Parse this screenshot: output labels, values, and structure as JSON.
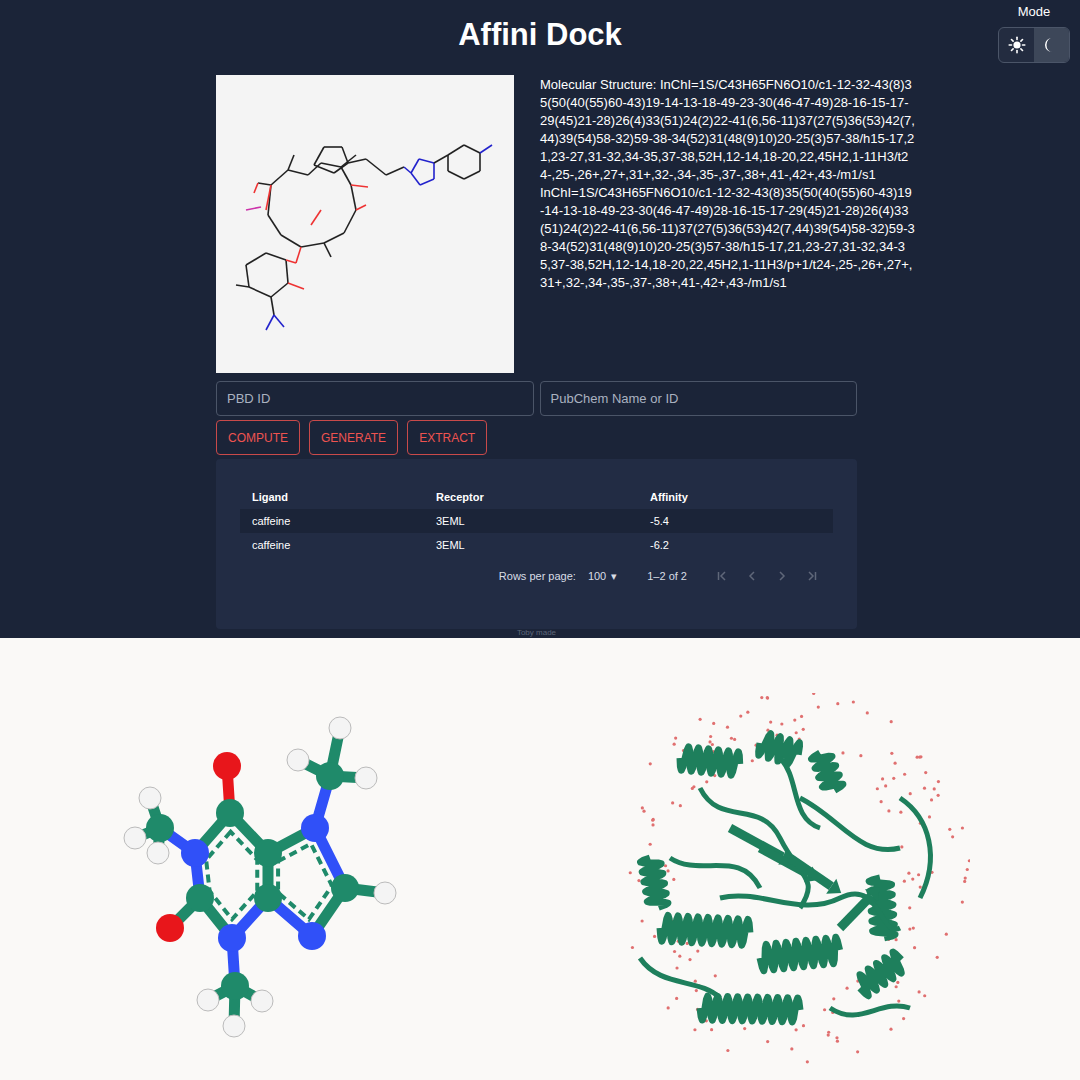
{
  "title": "Affini Dock",
  "mode": {
    "label": "Mode",
    "options": [
      {
        "kind": "light",
        "selected": false
      },
      {
        "kind": "dark",
        "selected": true
      }
    ]
  },
  "structure": {
    "label": "Molecular Structure:",
    "inchi": [
      "InChI=1S/C43H65FN6O10/c1-12-32-43(8)35(50(40(55)60-43)19-14-13-18-49-23-30(46-47-49)28-16-15-17-29(45)21-28)26(4)33(51)24(2)22-41(6,56-11)37(27(5)36(53)42(7,44)39(54)58-32)59-38-34(52)31(48(9)10)20-25(3)57-38/h15-17,21,23-27,31-32,34-35,37-38,52H,12-14,18-20,22,45H2,1-11H3/t24-,25-,26+,27+,31+,32-,34-,35-,37-,38+,41-,42+,43-/m1/s1",
      "InChI=1S/C43H65FN6O10/c1-12-32-43(8)35(50(40(55)60-43)19-14-13-18-49-23-30(46-47-49)28-16-15-17-29(45)21-28)26(4)33(51)24(2)22-41(6,56-11)37(27(5)36(53)42(7,44)39(54)58-32)59-38-34(52)31(48(9)10)20-25(3)57-38/h15-17,21,23-27,31-32,34-35,37-38,52H,12-14,18-20,22,45H2,1-11H3/p+1/t24-,25-,26+,27+,31+,32-,34-,35-,37-,38+,41-,42+,43-/m1/s1"
    ]
  },
  "inputs": [
    {
      "placeholder": "PBD ID"
    },
    {
      "placeholder": "PubChem Name or ID"
    }
  ],
  "buttons": [
    "COMPUTE",
    "GENERATE",
    "EXTRACT"
  ],
  "table": {
    "columns": [
      "Ligand",
      "Receptor",
      "Affinity"
    ],
    "rows": [
      {
        "cells": [
          "caffeine",
          "3EML",
          "-5.4"
        ],
        "selected": true
      },
      {
        "cells": [
          "caffeine",
          "3EML",
          "-6.2"
        ],
        "selected": false
      }
    ]
  },
  "pagination": {
    "label": "Rows per page:",
    "value": "100",
    "caret": "▾",
    "range": "1–2 of 2",
    "nav": [
      {
        "kind": "first",
        "disabled": true
      },
      {
        "kind": "prev",
        "disabled": true
      },
      {
        "kind": "next",
        "disabled": true
      },
      {
        "kind": "last",
        "disabled": true
      }
    ]
  },
  "footer": "Toby made"
}
